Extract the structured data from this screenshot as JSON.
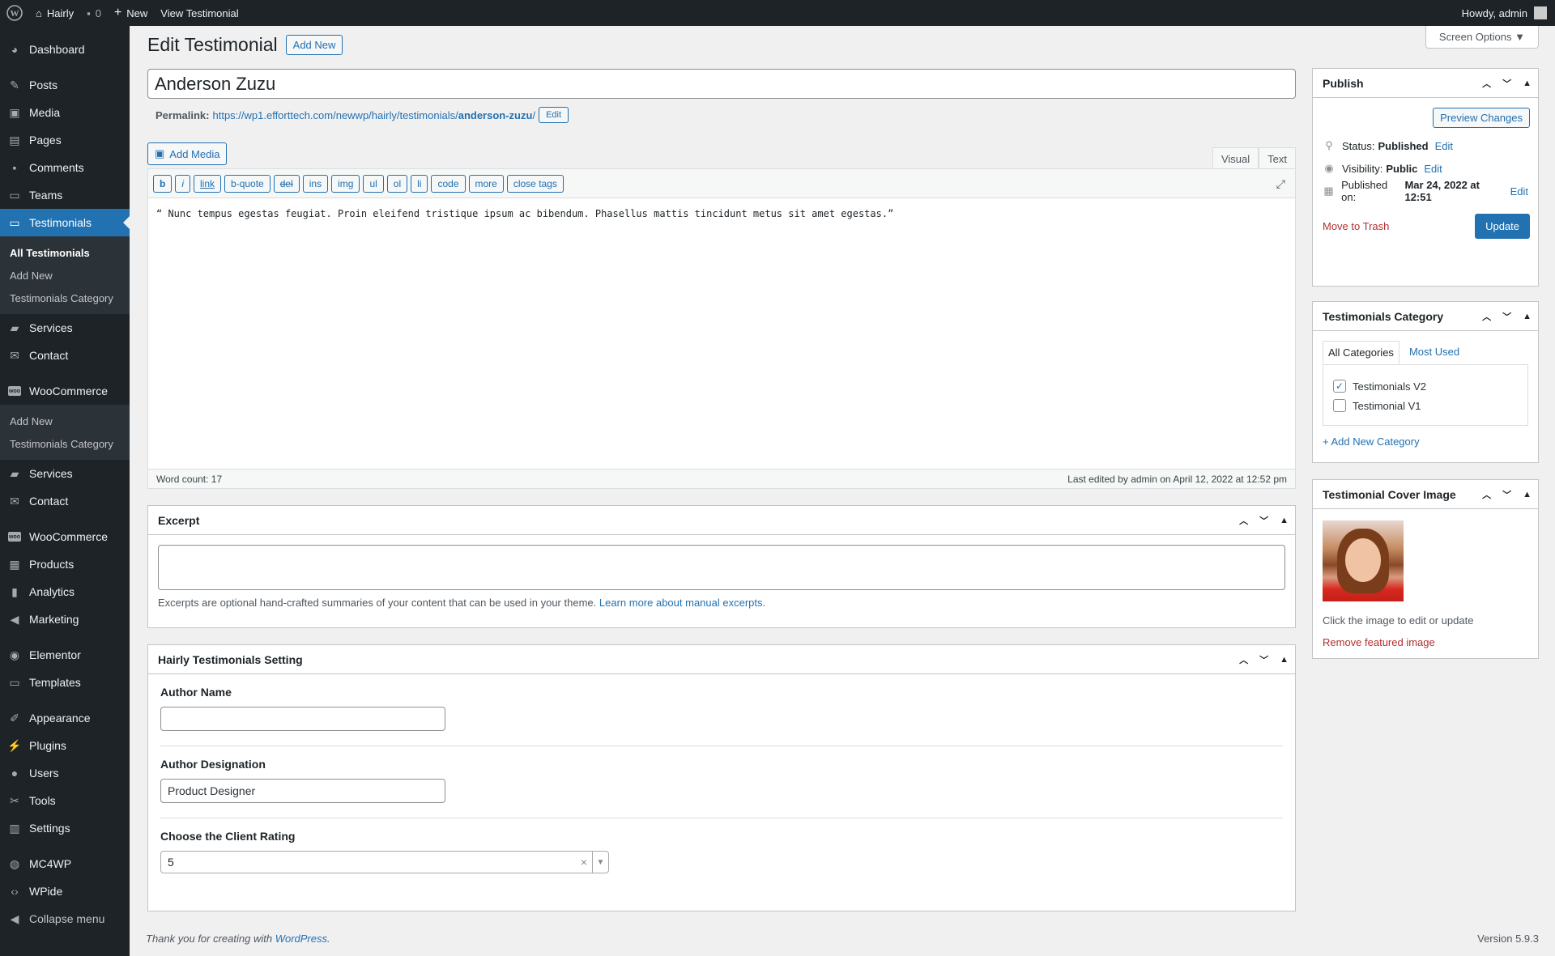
{
  "adminbar": {
    "site_name": "Hairly",
    "comments_count": "0",
    "new_label": "New",
    "view_label": "View Testimonial",
    "howdy": "Howdy, admin"
  },
  "sidebar": {
    "items": [
      {
        "label": "Dashboard",
        "icon": "dashboard-icon"
      },
      {
        "label": "Posts",
        "icon": "pin-icon"
      },
      {
        "label": "Media",
        "icon": "media-icon"
      },
      {
        "label": "Pages",
        "icon": "pages-icon"
      },
      {
        "label": "Comments",
        "icon": "comment-icon"
      },
      {
        "label": "Teams",
        "icon": "folder-icon"
      },
      {
        "label": "Testimonials",
        "icon": "folder-icon"
      },
      {
        "label": "Services",
        "icon": "briefcase-icon"
      },
      {
        "label": "Contact",
        "icon": "mail-icon"
      },
      {
        "label": "WooCommerce",
        "icon": "woo-icon"
      },
      {
        "label": "Services",
        "icon": "briefcase-icon"
      },
      {
        "label": "Contact",
        "icon": "mail-icon"
      },
      {
        "label": "WooCommerce",
        "icon": "woo-icon"
      },
      {
        "label": "Products",
        "icon": "archive-icon"
      },
      {
        "label": "Analytics",
        "icon": "chart-icon"
      },
      {
        "label": "Marketing",
        "icon": "megaphone-icon"
      },
      {
        "label": "Elementor",
        "icon": "elementor-icon"
      },
      {
        "label": "Templates",
        "icon": "folder-icon"
      },
      {
        "label": "Appearance",
        "icon": "brush-icon"
      },
      {
        "label": "Plugins",
        "icon": "plugin-icon"
      },
      {
        "label": "Users",
        "icon": "user-icon"
      },
      {
        "label": "Tools",
        "icon": "wrench-icon"
      },
      {
        "label": "Settings",
        "icon": "settings-icon"
      },
      {
        "label": "MC4WP",
        "icon": "mc4wp-icon"
      },
      {
        "label": "WPide",
        "icon": "code-icon"
      },
      {
        "label": "Collapse menu",
        "icon": "collapse-icon"
      }
    ],
    "testimonials_sub": [
      "All Testimonials",
      "Add New",
      "Testimonials Category"
    ],
    "woo_sub": [
      "Add New",
      "Testimonials Category"
    ]
  },
  "header": {
    "title": "Edit Testimonial",
    "add_new": "Add New",
    "screen_options": "Screen Options ▼"
  },
  "post": {
    "title": "Anderson Zuzu",
    "permalink_label": "Permalink:",
    "permalink_base": "https://wp1.efforttech.com/newwp/hairly/testimonials/",
    "permalink_slug": "anderson-zuzu",
    "permalink_trail": "/",
    "edit_label": "Edit"
  },
  "editor": {
    "add_media": "Add Media",
    "tab_visual": "Visual",
    "tab_text": "Text",
    "quicktags": [
      "b",
      "i",
      "link",
      "b-quote",
      "del",
      "ins",
      "img",
      "ul",
      "ol",
      "li",
      "code",
      "more",
      "close tags"
    ],
    "content": "“ Nunc tempus egestas feugiat. Proin eleifend tristique ipsum ac bibendum. Phasellus mattis tincidunt metus sit amet egestas.”",
    "word_count": "Word count: 17",
    "last_edited": "Last edited by admin on April 12, 2022 at 12:52 pm"
  },
  "excerpt": {
    "title": "Excerpt",
    "help_text": "Excerpts are optional hand-crafted summaries of your content that can be used in your theme.",
    "help_link": "Learn more about manual excerpts",
    "help_end": "."
  },
  "settings_box": {
    "title": "Hairly Testimonials Setting",
    "author_name_label": "Author Name",
    "author_name_value": "",
    "designation_label": "Author Designation",
    "designation_value": "Product Designer",
    "rating_label": "Choose the Client Rating",
    "rating_value": "5"
  },
  "publish": {
    "title": "Publish",
    "preview": "Preview Changes",
    "status_label": "Status:",
    "status_value": "Published",
    "visibility_label": "Visibility:",
    "visibility_value": "Public",
    "published_label": "Published on:",
    "published_value": "Mar 24, 2022 at 12:51",
    "edit": "Edit",
    "trash": "Move to Trash",
    "update": "Update"
  },
  "category_box": {
    "title": "Testimonials Category",
    "tab_all": "All Categories",
    "tab_used": "Most Used",
    "items": [
      {
        "label": "Testimonials V2",
        "checked": true
      },
      {
        "label": "Testimonial V1",
        "checked": false
      }
    ],
    "add_new": "+ Add New Category"
  },
  "cover_box": {
    "title": "Testimonial Cover Image",
    "hint": "Click the image to edit or update",
    "remove": "Remove featured image"
  },
  "footer": {
    "thanks": "Thank you for creating with ",
    "wp_link": "WordPress",
    "thanks_end": ".",
    "version": "Version 5.9.3"
  },
  "colors": {
    "accent": "#2271b1",
    "sidebar_bg": "#1d2327",
    "danger": "#b32d2e"
  }
}
